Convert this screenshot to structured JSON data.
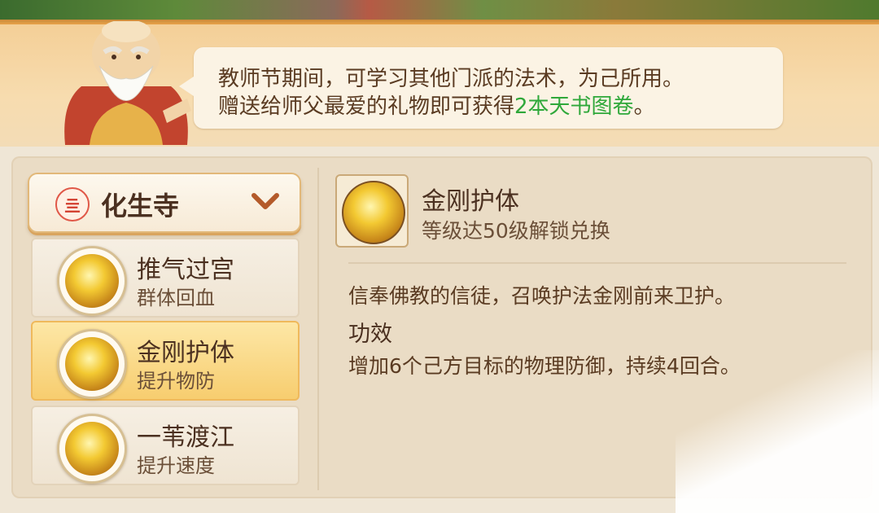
{
  "header": {
    "speech_line1": "教师节期间，可学习其他门派的法术，为己所用。",
    "speech_line2_prefix": "赠送给师父最爱的礼物即可获得",
    "speech_line2_highlight": "2本天书图卷",
    "speech_line2_suffix": "。",
    "highlight_color": "#2fa83a"
  },
  "school": {
    "emblem_glyph": "亖",
    "name": "化生寺",
    "chevron_icon": "chevron-down-icon"
  },
  "skills": [
    {
      "name": "推气过宫",
      "desc": "群体回血",
      "icon": "twin-monk-icon",
      "selected": false
    },
    {
      "name": "金刚护体",
      "desc": "提升物防",
      "icon": "guardian-vajra-icon",
      "selected": true
    },
    {
      "name": "一苇渡江",
      "desc": "提升速度",
      "icon": "reed-crossing-icon",
      "selected": false
    }
  ],
  "detail": {
    "title": "金刚护体",
    "unlock": "等级达50级解锁兑换",
    "description": "信奉佛教的信徒，召唤护法金刚前来卫护。",
    "effect_heading": "功效",
    "effect_text": "增加6个己方目标的物理防御，持续4回合。"
  }
}
